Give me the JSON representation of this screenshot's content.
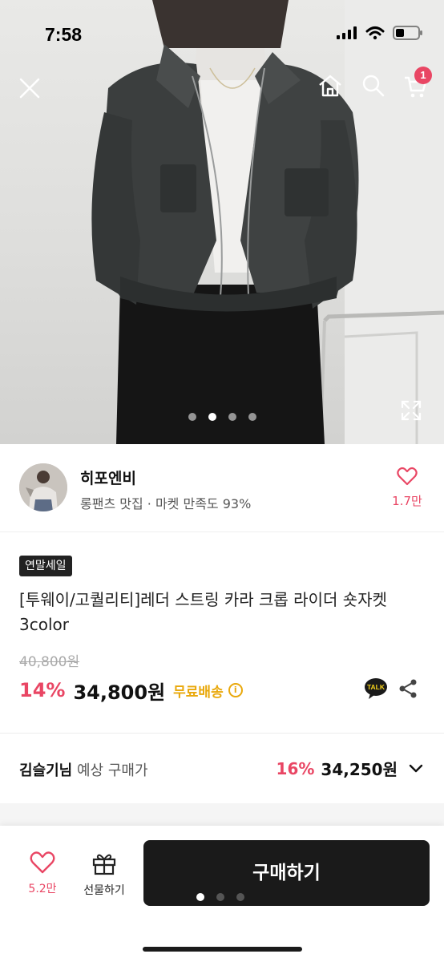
{
  "status_bar": {
    "time": "7:58"
  },
  "hero": {
    "close_icon": "close-icon",
    "home_icon": "home-icon",
    "search_icon": "search-icon",
    "cart_icon": "cart-icon",
    "cart_badge": "1",
    "expand_icon": "expand-icon",
    "slide_count": 4,
    "active_slide": 2
  },
  "seller": {
    "name": "히포엔비",
    "description": "롱팬츠 맛집 · 마켓 만족도 93%",
    "like_count": "1.7만"
  },
  "product": {
    "badge": "연말세일",
    "title": "[투웨이/고퀄리티]레더 스트링 카라 크롭 라이더 숏자켓 3color",
    "original_price": "40,800원",
    "discount": "14%",
    "price": "34,800원",
    "shipping": "무료배송",
    "talk_label": "TALK"
  },
  "expected_price": {
    "user": "김슬기님",
    "label": "예상 구매가",
    "discount": "16%",
    "price": "34,250원"
  },
  "bottom_bar": {
    "like_count": "5.2만",
    "gift_label": "선물하기",
    "buy_label": "구매하기"
  },
  "colors": {
    "accent": "#e94664",
    "shipping": "#e9a80b",
    "buy_button": "#1a1a1a"
  }
}
